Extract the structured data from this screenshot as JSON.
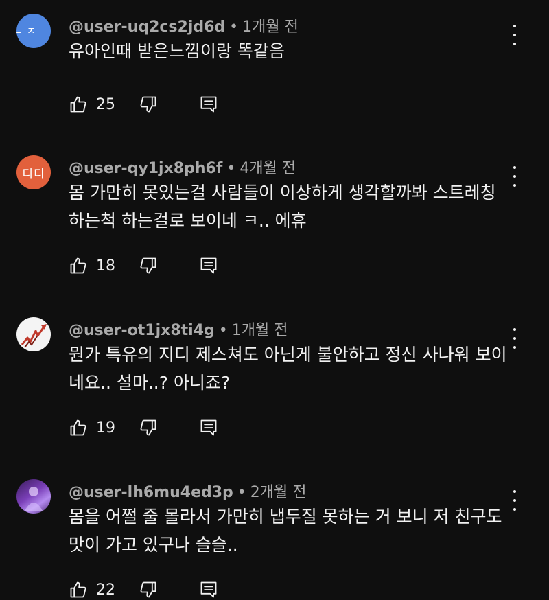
{
  "comments": [
    {
      "avatar_text": "ㄴㅈ",
      "handle": "@user-uq2cs2jd6d",
      "time": "1개월 전",
      "text": "유아인때 받은느낌이랑 똑같음",
      "likes": "25"
    },
    {
      "avatar_text": "디디",
      "handle": "@user-qy1jx8ph6f",
      "time": "4개월 전",
      "text": "몸 가만히 못있는걸 사람들이 이상하게 생각할까봐 스트레칭 하는척 하는걸로 보이네 ㅋ.. 에휴",
      "likes": "18"
    },
    {
      "avatar_text": "",
      "handle": "@user-ot1jx8ti4g",
      "time": "1개월 전",
      "text": "뭔가 특유의 지디 제스쳐도 아닌게 불안하고 정신 사나워 보이네요.. 설마..? 아니죠?",
      "likes": "19"
    },
    {
      "avatar_text": "",
      "handle": "@user-lh6mu4ed3p",
      "time": "2개월 전",
      "text": "몸을 어쩔 줄 몰라서 가만히 냅두질 못하는 거 보니 저 친구도 맛이 가고 있구나 슬슬..",
      "likes": "22"
    }
  ],
  "separator": "•",
  "icons": {
    "like": "thumbs-up-icon",
    "dislike": "thumbs-down-icon",
    "reply": "reply-comment-icon",
    "menu": "more-vert-icon"
  },
  "colors": {
    "background": "#0f0f0f",
    "text": "#f1f1f1",
    "meta": "#aaaaaa"
  }
}
